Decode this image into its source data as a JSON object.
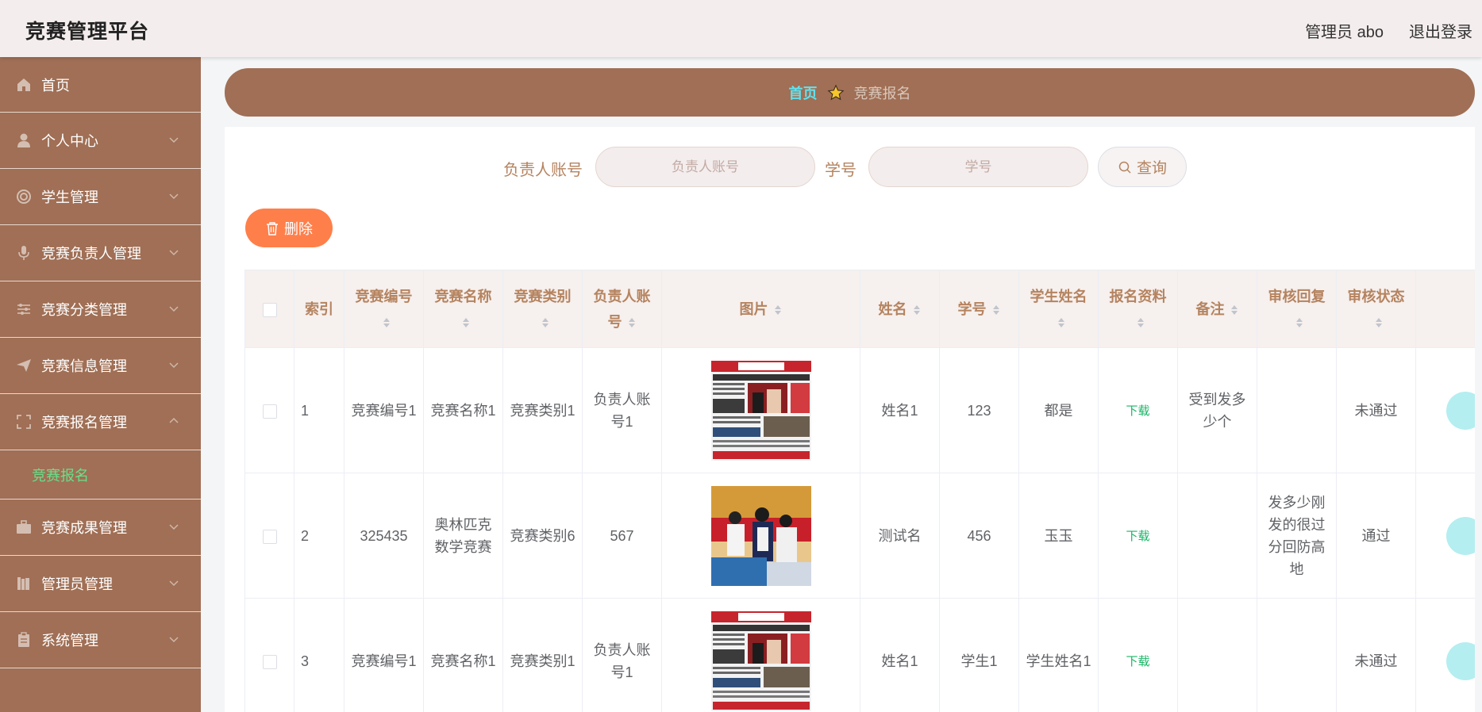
{
  "app": {
    "title": "竞赛管理平台",
    "admin_label": "管理员 abo",
    "logout_label": "退出登录"
  },
  "sidebar": {
    "items": [
      {
        "label": "首页",
        "icon": "home-icon"
      },
      {
        "label": "个人中心",
        "icon": "user-icon"
      },
      {
        "label": "学生管理",
        "icon": "circle-icon"
      },
      {
        "label": "竞赛负责人管理",
        "icon": "microphone-icon"
      },
      {
        "label": "竞赛分类管理",
        "icon": "sliders-icon"
      },
      {
        "label": "竞赛信息管理",
        "icon": "send-icon"
      },
      {
        "label": "竞赛报名管理",
        "icon": "fullscreen-icon"
      },
      {
        "label": "竞赛成果管理",
        "icon": "briefcase-icon"
      },
      {
        "label": "管理员管理",
        "icon": "books-icon"
      },
      {
        "label": "系统管理",
        "icon": "clipboard-icon"
      }
    ],
    "active_sub": "竞赛报名"
  },
  "breadcrumb": {
    "home": "首页",
    "current": "竞赛报名"
  },
  "search": {
    "account_label": "负责人账号",
    "account_placeholder": "负责人账号",
    "student_no_label": "学号",
    "student_no_placeholder": "学号",
    "query_label": "查询"
  },
  "toolbar": {
    "delete_label": "删除"
  },
  "table": {
    "headers": [
      "索引",
      "竞赛编号",
      "竞赛名称",
      "竞赛类别",
      "负责人账号",
      "图片",
      "姓名",
      "学号",
      "学生姓名",
      "报名资料",
      "备注",
      "审核回复",
      "审核状态"
    ],
    "rows": [
      {
        "index": "1",
        "code": "竞赛编号1",
        "name": "竞赛名称1",
        "category": "竞赛类别1",
        "account": "负责人账号1",
        "image": "newspaper",
        "real_name": "姓名1",
        "student_no": "123",
        "student_name": "都是",
        "file": "下载",
        "remark": "受到发多少个",
        "reply": "",
        "status": "未通过"
      },
      {
        "index": "2",
        "code": "325435",
        "name": "奥林匹克数学竞赛",
        "category": "竞赛类别6",
        "account": "567",
        "image": "students",
        "real_name": "测试名",
        "student_no": "456",
        "student_name": "玉玉",
        "file": "下载",
        "remark": "",
        "reply": "发多少刚发的很过分回防高地",
        "status": "通过"
      },
      {
        "index": "3",
        "code": "竞赛编号1",
        "name": "竞赛名称1",
        "category": "竞赛类别1",
        "account": "负责人账号1",
        "image": "newspaper",
        "real_name": "姓名1",
        "student_no": "学生1",
        "student_name": "学生姓名1",
        "file": "下载",
        "remark": "",
        "reply": "",
        "status": "未通过"
      }
    ]
  },
  "colors": {
    "primary": "#a06f55",
    "accent": "#5fe3f0",
    "delete": "#ff7f4a",
    "download": "#18b566"
  }
}
